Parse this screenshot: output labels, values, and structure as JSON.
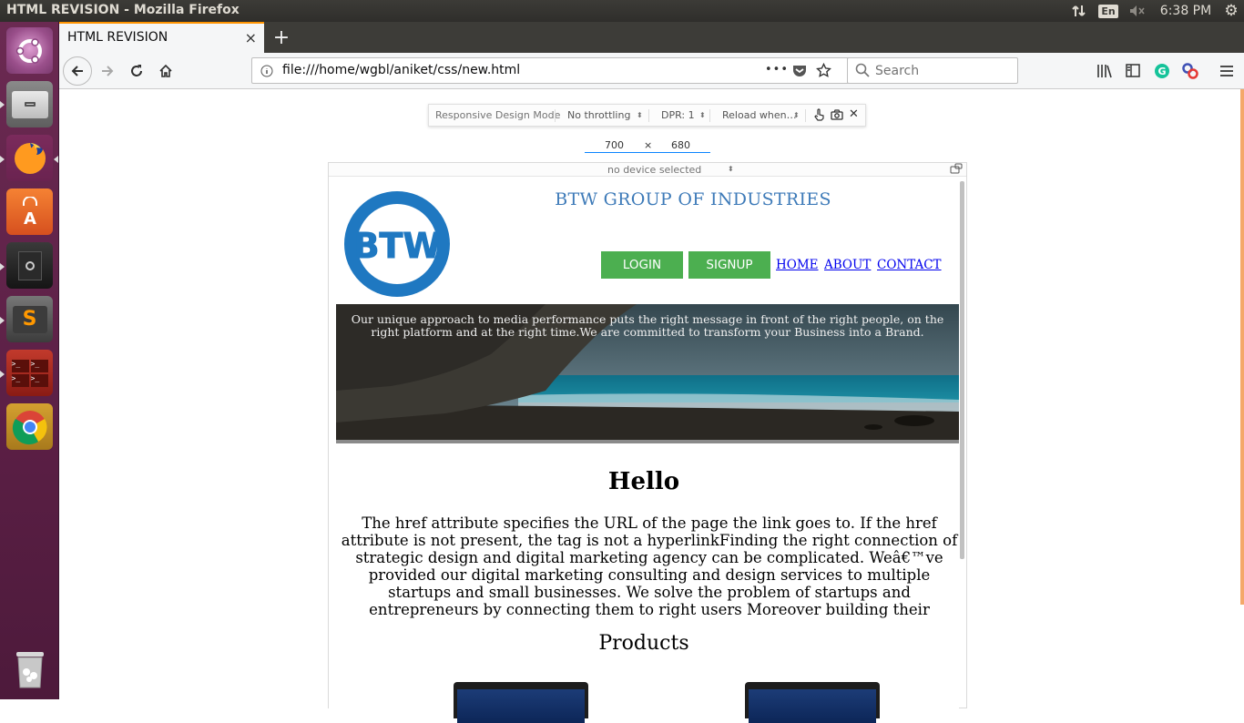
{
  "top_panel": {
    "window_title": "HTML REVISION - Mozilla Firefox",
    "keyboard_layout": "En",
    "time": "6:38 PM"
  },
  "launcher": {
    "items": [
      "Ubuntu Dash",
      "Files",
      "Firefox",
      "Ubuntu Software",
      "Unknown App",
      "Sublime Text",
      "Terminal",
      "Chrome",
      "Trash"
    ]
  },
  "browser": {
    "tab": {
      "title": "HTML REVISION",
      "close": "×"
    },
    "new_tab": "+",
    "url": "file:///home/wgbl/aniket/css/new.html",
    "url_menu": "•••",
    "search_placeholder": "Search"
  },
  "rdm": {
    "mode_label": "Responsive Design Mode",
    "throttling": "No throttling",
    "dpr": "DPR: 1",
    "reload": "Reload when…",
    "width": "700",
    "times": "×",
    "height": "680",
    "device": "no device selected"
  },
  "page": {
    "company": "BTW GROUP OF INDUSTRIES",
    "logo_text": "BTW",
    "login": "LOGIN",
    "signup": "SIGNUP",
    "nav": [
      "HOME",
      "ABOUT",
      "CONTACT"
    ],
    "hero_text": "Our unique approach to media performance puts the right message in front of the right people, on the right platform and at the right time.We are committed to transform your Business into a Brand.",
    "heading": "Hello",
    "paragraph": "The href attribute specifies the URL of the page the link goes to. If the href attribute is not present, the tag is not a hyperlinkFinding the right connection of strategic design and digital marketing agency can be complicated. Weâ€™ve provided our digital marketing consulting and design services to multiple startups and small businesses. We solve the problem of startups and entrepreneurs by connecting them to right users Moreover building their",
    "products_heading": "Products"
  },
  "colors": {
    "accent_green": "#4caf50",
    "company_blue": "#3d7ab8",
    "logo_blue": "#1f78c1",
    "tab_accent": "#ff9400",
    "launcher": "#5b1f45"
  }
}
